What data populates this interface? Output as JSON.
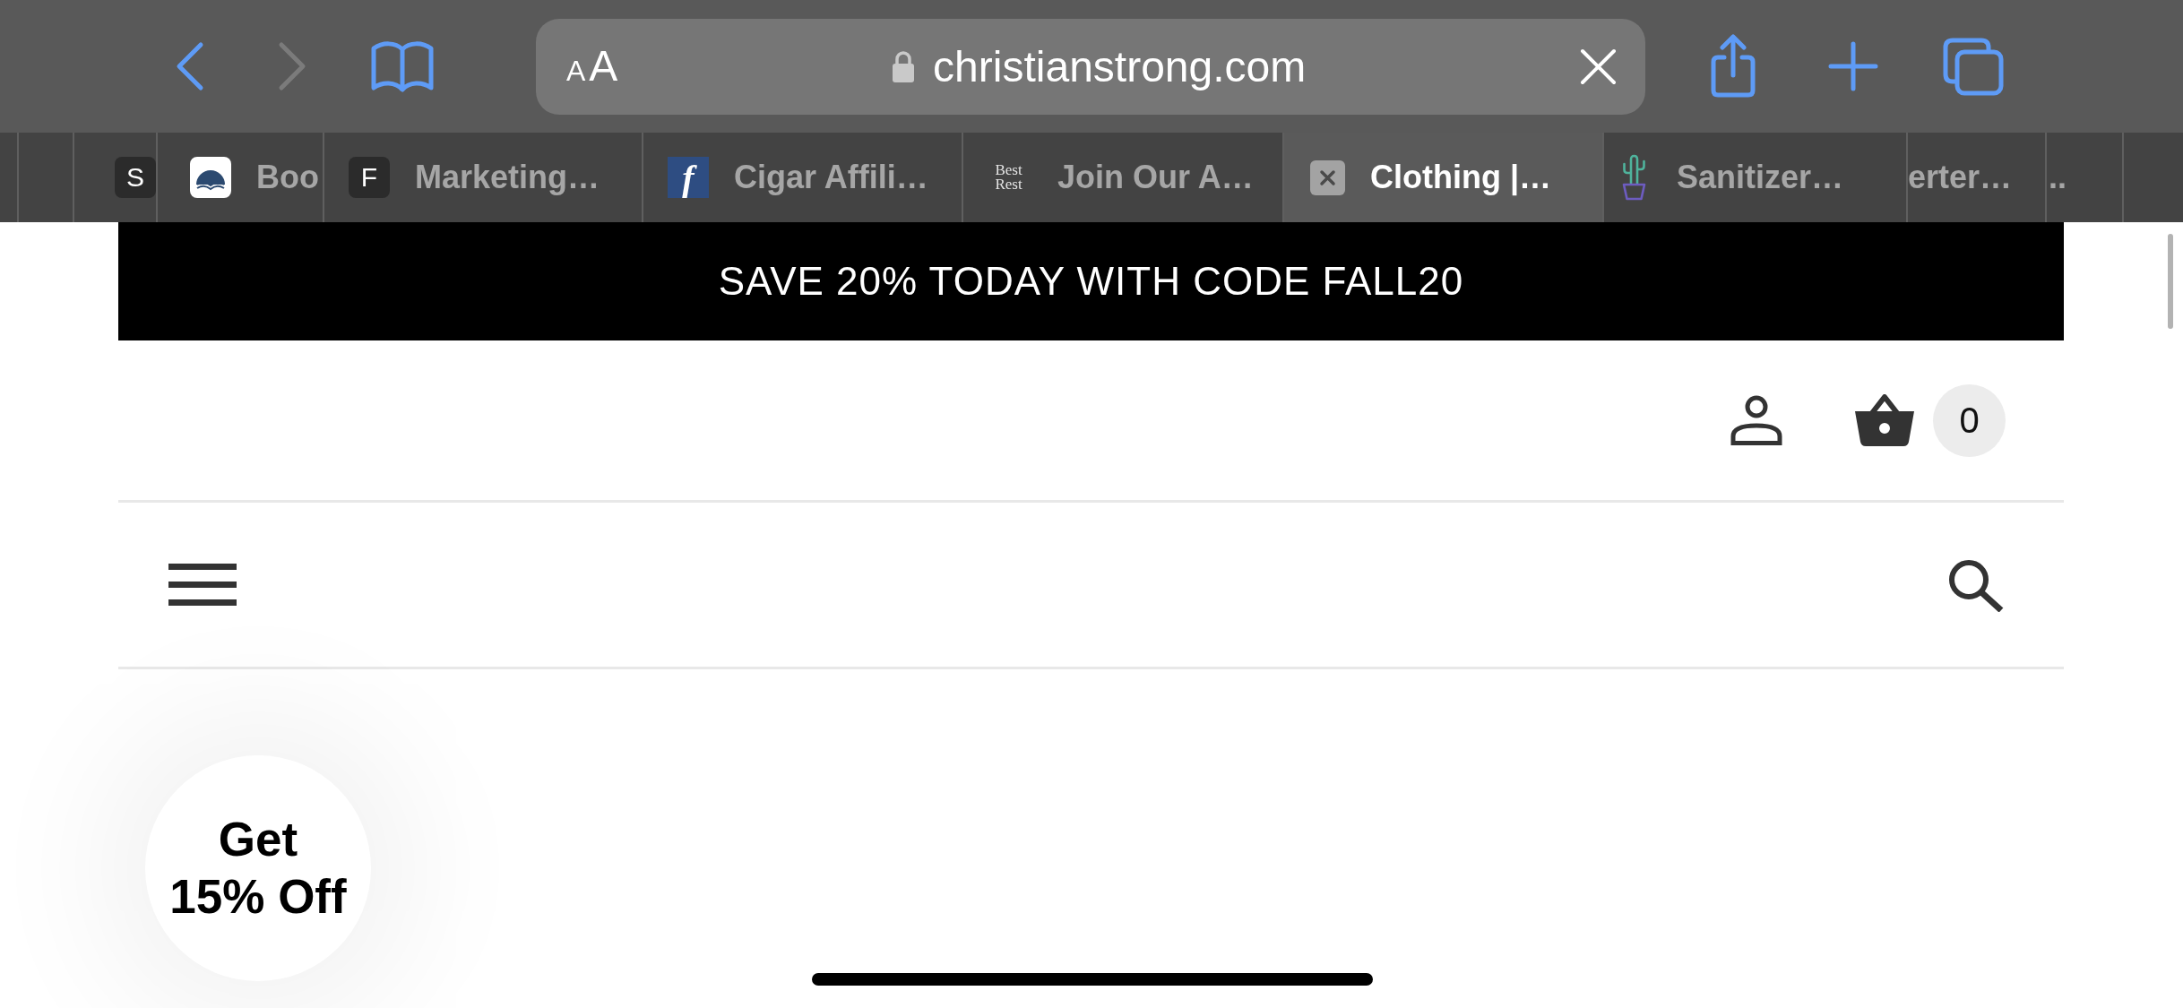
{
  "navigation": [
    {
      "kind": "back",
      "disabled": false
    },
    {
      "kind": "forward",
      "disabled": true
    }
  ],
  "address_bar": {
    "text_size_button": {
      "small": "A",
      "large": "A"
    },
    "url": "christianstrong.com"
  },
  "tabs": [
    {
      "favicon": {
        "kind": "letter",
        "text": "S"
      },
      "selected": false
    },
    {
      "favicon": {
        "kind": "book"
      },
      "title": "Boo",
      "selected": false
    },
    {
      "favicon": {
        "kind": "letter",
        "text": "F"
      },
      "title": "Marketing…",
      "selected": false
    },
    {
      "favicon": {
        "kind": "script_letter",
        "text": "f"
      },
      "title": "Cigar Affili…",
      "selected": false
    },
    {
      "favicon": {
        "kind": "wordmark",
        "text": "Best Rest"
      },
      "title": "Join Our A…",
      "selected": false
    },
    {
      "favicon": {
        "kind": "placeholder"
      },
      "title": "Clothing |…",
      "selected": true
    },
    {
      "favicon": {
        "kind": "cactus"
      },
      "title": "Sanitizer…",
      "selected": false
    },
    {
      "title": "erter…",
      "selected": false
    },
    {
      "title": "..",
      "selected": false
    }
  ],
  "announcement": "SAVE 20% TODAY WITH CODE FALL20",
  "cart": {
    "count": "0"
  },
  "discount_button": "Get 15% Off"
}
